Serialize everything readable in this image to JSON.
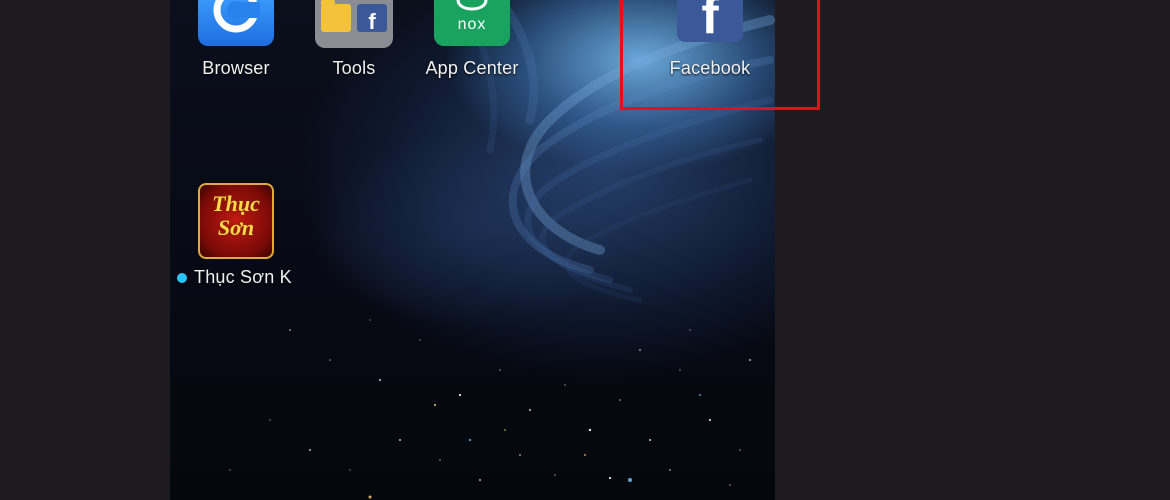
{
  "home_screen": {
    "apps": [
      {
        "label": "Browser"
      },
      {
        "label": "Tools"
      },
      {
        "label": "App Center",
        "icon_text": "nox"
      },
      {
        "label": "Facebook",
        "icon_text": "f"
      },
      {
        "label": "Thục Sơn K",
        "icon_text_line1": "Thục",
        "icon_text_line2": "Sơn"
      }
    ]
  },
  "highlight_color": "#e3101a",
  "notification_dot_color": "#29c5f6"
}
